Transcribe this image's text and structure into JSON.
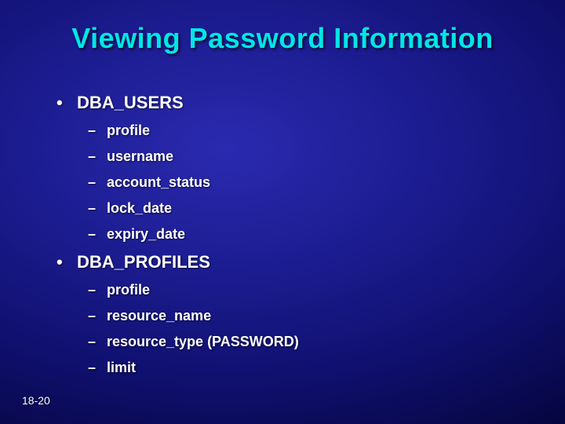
{
  "title": "Viewing Password Information",
  "bullets": [
    {
      "level": 1,
      "text": "DBA_USERS"
    },
    {
      "level": 2,
      "text": "profile"
    },
    {
      "level": 2,
      "text": "username"
    },
    {
      "level": 2,
      "text": "account_status"
    },
    {
      "level": 2,
      "text": "lock_date"
    },
    {
      "level": 2,
      "text": "expiry_date"
    },
    {
      "level": 1,
      "text": "DBA_PROFILES"
    },
    {
      "level": 2,
      "text": "profile"
    },
    {
      "level": 2,
      "text": "resource_name"
    },
    {
      "level": 2,
      "text": "resource_type (PASSWORD)"
    },
    {
      "level": 2,
      "text": "limit"
    }
  ],
  "footer": "18-20",
  "glyphs": {
    "l1": "•",
    "l2": "–"
  }
}
